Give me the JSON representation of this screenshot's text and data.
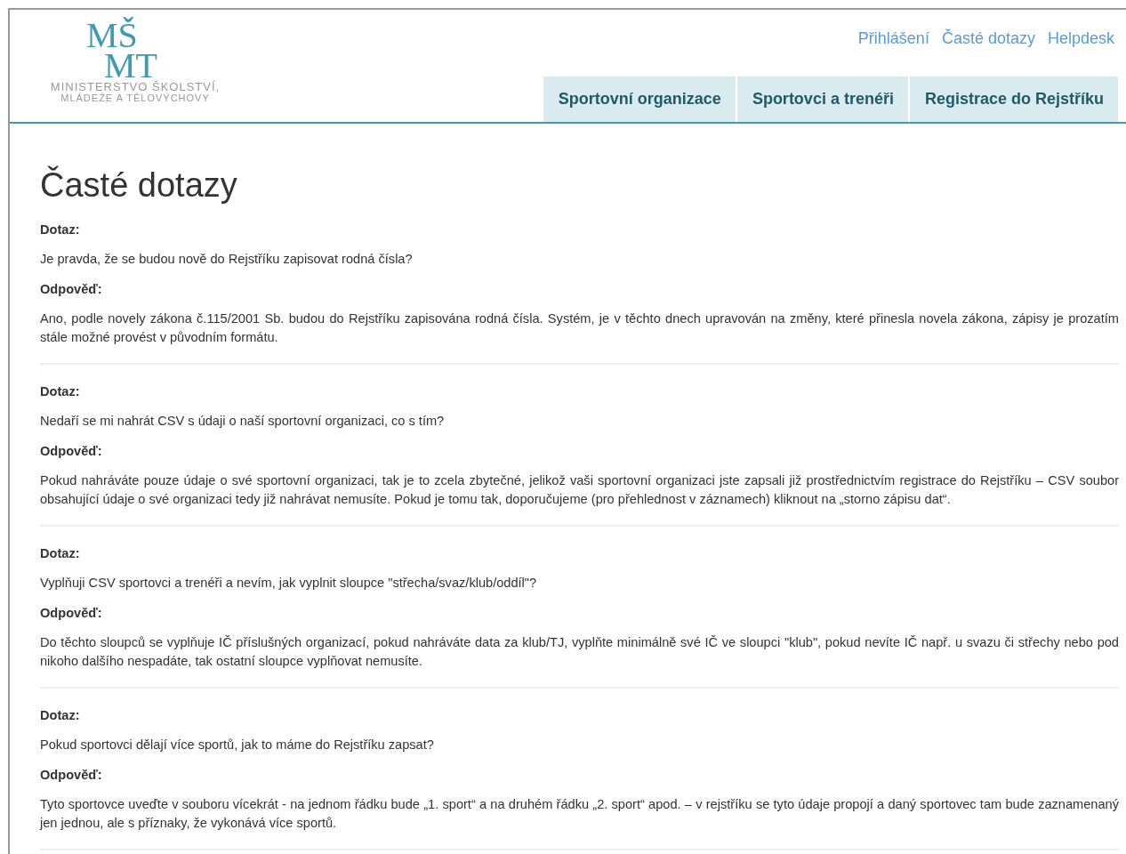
{
  "logo": {
    "mark_top": "MŠ",
    "mark_bottom": "MT",
    "line_1": "MINISTERSTVO ŠKOLSTVÍ,",
    "line_2": "MLÁDEŽE A TĚLOVÝCHOVY"
  },
  "top_links": [
    "Přihlášení",
    "Časté dotazy",
    "Helpdesk"
  ],
  "nav": [
    "Sportovní organizace",
    "Sportovci a trenéři",
    "Registrace do Rejstříku"
  ],
  "title": "Časté dotazy",
  "faq": [
    {
      "question_label": "Dotaz:",
      "question": "Je pravda, že se budou nově do Rejstříku zapisovat rodná čísla?",
      "answer_label": "Odpověď:",
      "answer": "Ano, podle novely zákona č.115/2001 Sb. budou do Rejstříku zapisována rodná čísla. Systém, je v těchto dnech upravován na změny, které přinesla novela zákona, zápisy je prozatím stále možné provést v původním formátu."
    },
    {
      "question_label": "Dotaz:",
      "question": "Nedaří se mi nahrát CSV s údaji o naší sportovní organizaci, co s tím?",
      "answer_label": "Odpověď:",
      "answer": "Pokud nahráváte pouze údaje o své sportovní organizaci, tak je to zcela zbytečné, jelikož vaši sportovní organizaci jste zapsali již prostřednictvím registrace do Rejstříku – CSV soubor obsahující údaje o své organizaci tedy již nahrávat nemusíte. Pokud je tomu tak, doporučujeme (pro přehlednost v záznamech) kliknout na „storno zápisu dat“."
    },
    {
      "question_label": "Dotaz:",
      "question": "Vyplňuji CSV sportovci a trenéři a nevím, jak vyplnit sloupce \"střecha/svaz/klub/oddíl\"?",
      "answer_label": "Odpověď:",
      "answer": "Do těchto sloupců se vyplňuje IČ příslušných organizací, pokud nahráváte data za klub/TJ, vyplňte minimálně své IČ ve sloupci \"klub\", pokud nevíte IČ např. u svazu či střechy nebo pod nikoho dalšího nespadáte, tak ostatní sloupce vyplňovat nemusíte."
    },
    {
      "question_label": "Dotaz:",
      "question": "Pokud sportovci dělají více sportů, jak to máme do Rejstříku zapsat?",
      "answer_label": "Odpověď:",
      "answer": "Tyto sportovce uveďte v souboru vícekrát - na jednom řádku bude „1. sport“ a na druhém řádku „2. sport“ apod. – v rejstříku se tyto údaje propojí a daný sportovec tam bude zaznamenaný jen jednou, ale s příznaky, že vykonává více sportů."
    }
  ]
}
